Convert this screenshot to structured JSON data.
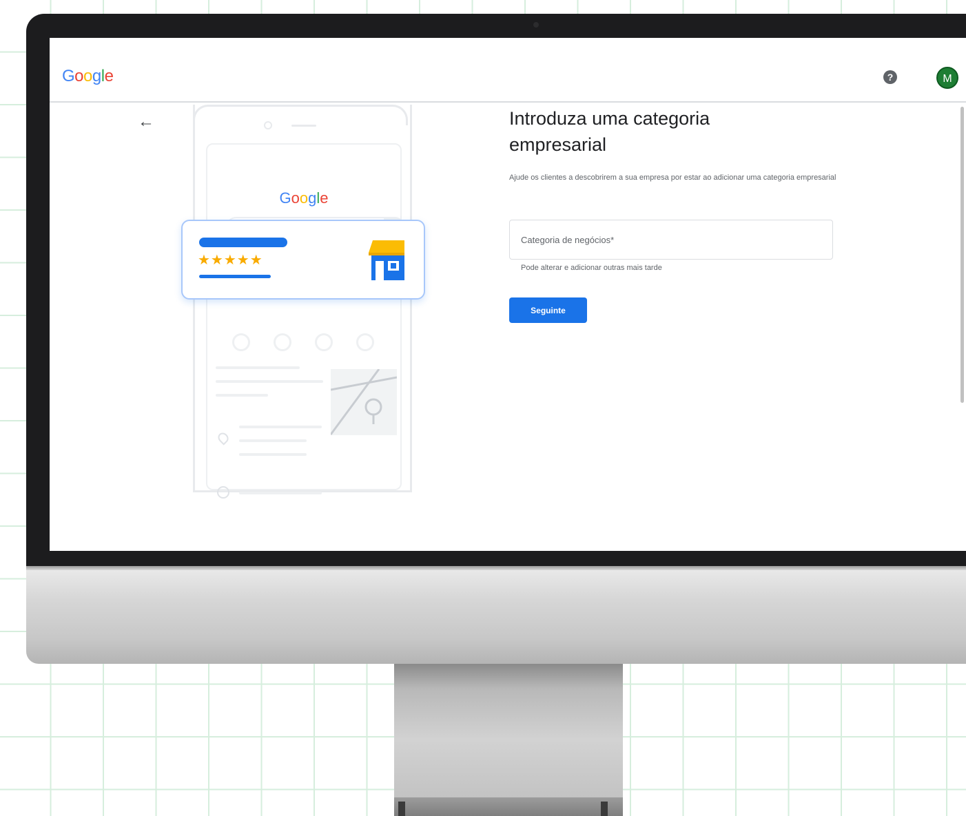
{
  "header": {
    "logo_letters": [
      {
        "ch": "G",
        "color": "#4285f4"
      },
      {
        "ch": "o",
        "color": "#ea4335"
      },
      {
        "ch": "o",
        "color": "#fbbc05"
      },
      {
        "ch": "g",
        "color": "#4285f4"
      },
      {
        "ch": "l",
        "color": "#34a853"
      },
      {
        "ch": "e",
        "color": "#ea4335"
      }
    ],
    "help_icon": "help-circle-icon",
    "help_glyph": "?",
    "avatar_initial": "M"
  },
  "illustration": {
    "brand_letters": [
      {
        "ch": "G",
        "color": "#4285f4"
      },
      {
        "ch": "o",
        "color": "#ea4335"
      },
      {
        "ch": "o",
        "color": "#fbbc05"
      },
      {
        "ch": "g",
        "color": "#4285f4"
      },
      {
        "ch": "l",
        "color": "#34a853"
      },
      {
        "ch": "e",
        "color": "#ea4335"
      }
    ],
    "stars": "★★★★★",
    "rating": 5,
    "chevron": "›"
  },
  "main": {
    "back_glyph": "←",
    "title": "Introduza uma categoria empresarial",
    "description": "Ajude os clientes a descobrirem a sua empresa por estar ao adicionar uma categoria empresarial",
    "field_placeholder": "Categoria de negócios*",
    "field_hint": "Pode alterar e adicionar outras mais tarde",
    "next_label": "Seguinte"
  },
  "colors": {
    "accent": "#1a73e8",
    "avatar": "#1e7e34",
    "star": "#f9ab00",
    "grid": "#d6eedd"
  }
}
